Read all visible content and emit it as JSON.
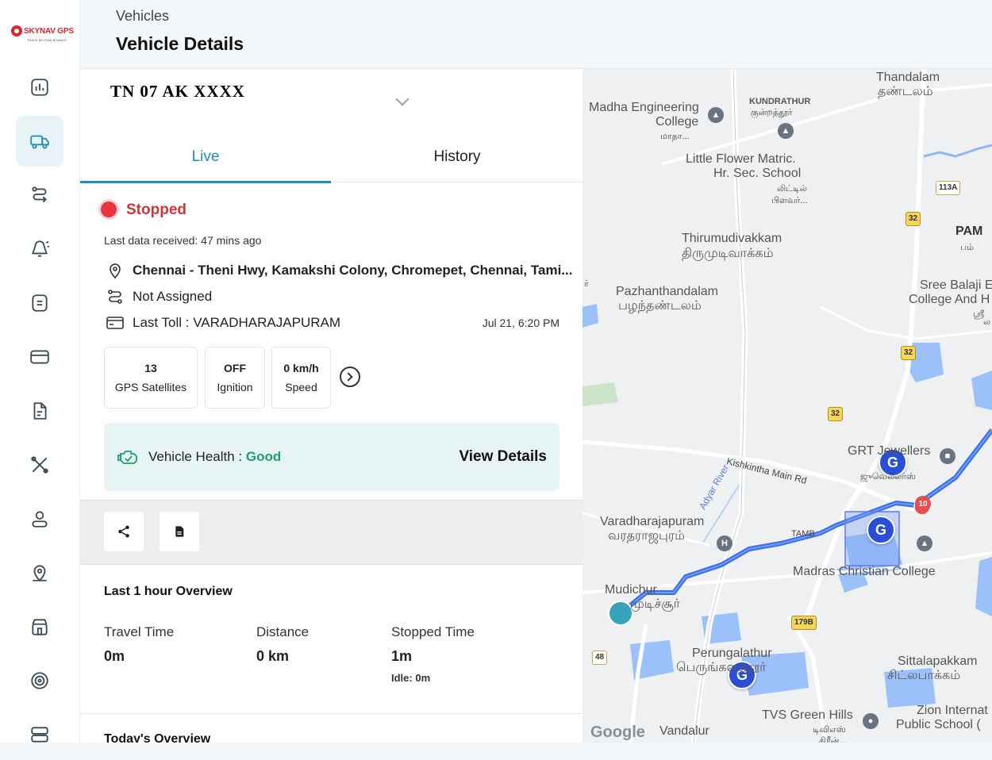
{
  "brand": {
    "logo_text": "SKYNAV GPS",
    "tagline": "TRACK BEYOND BOUNDS"
  },
  "sidebar": {
    "items": [
      {
        "icon": "dashboard-chart-icon"
      },
      {
        "icon": "truck-icon",
        "active": true
      },
      {
        "icon": "route-icon"
      },
      {
        "icon": "alert-bell-icon"
      },
      {
        "icon": "document-list-icon"
      },
      {
        "icon": "card-icon"
      },
      {
        "icon": "report-file-icon"
      },
      {
        "icon": "tools-icon"
      },
      {
        "icon": "user-icon"
      },
      {
        "icon": "location-user-icon"
      },
      {
        "icon": "building-icon"
      },
      {
        "icon": "tyre-icon"
      },
      {
        "icon": "storage-icon"
      }
    ]
  },
  "header": {
    "breadcrumb": "Vehicles",
    "title": "Vehicle Details"
  },
  "vehicle": {
    "selected": "TN 07 AK XXXX"
  },
  "tabs": {
    "live": "Live",
    "history": "History"
  },
  "status": {
    "label": "Stopped",
    "last_data": "Last data received: 47 mins ago",
    "address": "Chennai - Theni Hwy, Kamakshi Colony, Chromepet, Chennai, Tami...",
    "driver": "Not Assigned",
    "last_toll": "Last Toll : VARADHARAJAPURAM",
    "toll_time": "Jul 21, 6:20 PM"
  },
  "stats": [
    {
      "value": "13",
      "label": "GPS Satellites"
    },
    {
      "value": "OFF",
      "label": "Ignition"
    },
    {
      "value": "0 km/h",
      "label": "Speed"
    }
  ],
  "health": {
    "label": "Vehicle Health : ",
    "value": "Good",
    "link": "View Details",
    "value_color": "#1f9e6e"
  },
  "overview": {
    "title": "Last 1 hour Overview",
    "travel_label": "Travel Time",
    "travel_value": "0m",
    "distance_label": "Distance",
    "distance_value": "0 km",
    "stopped_label": "Stopped Time",
    "stopped_value": "1m",
    "idle": "Idle: 0m"
  },
  "today": {
    "title": "Today's Overview"
  },
  "map": {
    "labels": {
      "thandalam": "Thandalam",
      "thandalam_ta": "தண்டலம்",
      "madha": "Madha Engineering",
      "college": "College",
      "madha_ta": "மாதா...",
      "kundrathur": "KUNDRATHUR",
      "kundrathur_ta": "குன்றத்தூர்",
      "little_flower": "Little Flower Matric.",
      "hr_sec": "Hr. Sec. School",
      "lf_ta1": "லிட்டில்",
      "lf_ta2": "பிளவர்...",
      "thirumudivakkam": "Thirumudivakkam",
      "thirumudivakkam_ta": "திருமுடிவாக்கம்",
      "pazhanthandalam": "Pazhanthandalam",
      "pazhanthandalam_ta": "பழந்தண்டலம்",
      "sree_balaji": "Sree Balaji E",
      "college_and": "College And H",
      "sb_ta": "ஸ்ரீ",
      "pam": "PAM",
      "pam_ta": "பம்",
      "grt": "GRT Jewellers",
      "grt_ta": "ஜுவெல்லர்ஸ்",
      "kishkintha": "Kishkintha Main Rd",
      "adyar": "Adyar River",
      "varadharajapuram": "Varadharajapuram",
      "varadharajapuram_ta": "வரதராஜபுரம்",
      "tamb": "TAMB",
      "mcc": "Madras Christian College",
      "mudichur": "Mudichur",
      "mudichur_ta": "முடிச்சூர்",
      "perungalathur": "Perungalathur",
      "perungalathur_ta": "பெருங்களத்தூர்",
      "sittalapakkam": "Sittalapakkam",
      "sittalapakkam_ta": "சிட்லபாக்கம்",
      "tvs": "TVS Green Hills",
      "tvs_ta": "டிவிஎஸ்",
      "tvs_ta2": "கிரீன்...",
      "zion": "Zion Internat",
      "public_school": "Public School (",
      "vandalur": "Vandalur",
      "google": "Google",
      "ta_r": "ர்",
      "pam_edge": "ல"
    },
    "badges": {
      "r113a": "113A",
      "r32a": "32",
      "r32b": "32",
      "r32c": "32",
      "r179b": "179B",
      "r48": "48"
    },
    "cluster_count": "10",
    "marker": "G"
  }
}
